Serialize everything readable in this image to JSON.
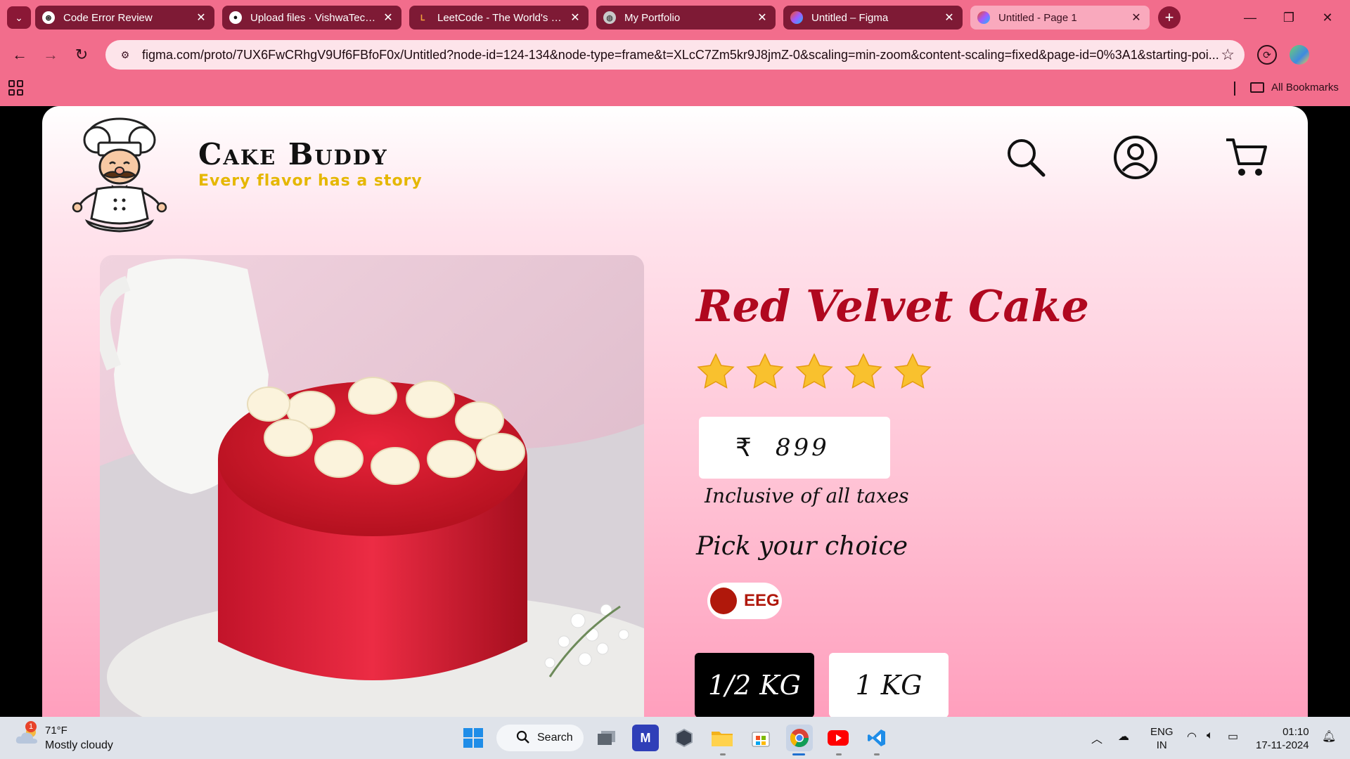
{
  "browser": {
    "tabs": [
      {
        "title": "Code Error Review",
        "favicon": "chatgpt-icon"
      },
      {
        "title": "Upload files · VishwaTechy/",
        "favicon": "github-icon"
      },
      {
        "title": "LeetCode - The World's Lea",
        "favicon": "leetcode-icon"
      },
      {
        "title": "My Portfolio",
        "favicon": "globe-icon"
      },
      {
        "title": "Untitled – Figma",
        "favicon": "figma-icon"
      },
      {
        "title": "Untitled - Page 1",
        "favicon": "figma-icon",
        "active": true
      }
    ],
    "url": "figma.com/proto/7UX6FwCRhgV9Uf6FBfoF0x/Untitled?node-id=124-134&node-type=frame&t=XLcC7Zm5kr9J8jmZ-0&scaling=min-zoom&content-scaling=fixed&page-id=0%3A1&starting-poi...",
    "bookmarks_label": "All Bookmarks"
  },
  "site": {
    "brand": "Cake Buddy",
    "tagline": "Every flavor has a story"
  },
  "product": {
    "name": "Red Velvet Cake",
    "rating": 5,
    "rating_max": 5,
    "currency_symbol": "₹",
    "price": "899",
    "tax_note": "Inclusive of all taxes",
    "choice_label": "Pick your choice",
    "variant": "EEG",
    "variant_color": "#b0180b",
    "weights": [
      {
        "label": "1/2 KG",
        "selected": true
      },
      {
        "label": "1 KG",
        "selected": false
      }
    ]
  },
  "taskbar": {
    "temperature": "71°F",
    "condition": "Mostly cloudy",
    "weather_badge": "1",
    "search_label": "Search",
    "lang_line1": "ENG",
    "lang_line2": "IN",
    "time": "01:10",
    "date": "17-11-2024"
  },
  "colors": {
    "chrome": "#f26d8c",
    "title_red": "#b0081f",
    "tagline_gold": "#e5b700"
  }
}
